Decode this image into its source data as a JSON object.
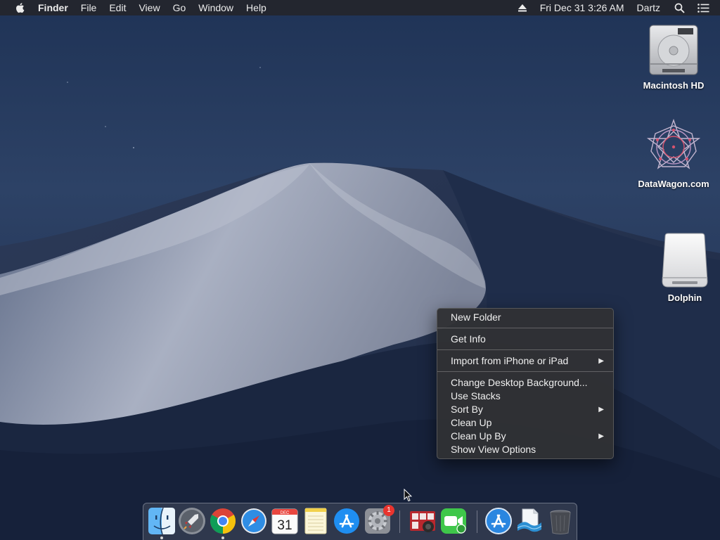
{
  "menubar": {
    "app_name": "Finder",
    "menus": [
      "File",
      "Edit",
      "View",
      "Go",
      "Window",
      "Help"
    ],
    "clock": "Fri Dec 31  3:26 AM",
    "user": "Dartz"
  },
  "desktop_icons": {
    "macintosh_hd": "Macintosh HD",
    "datawagon": "DataWagon.com",
    "dolphin": "Dolphin"
  },
  "context_menu": {
    "new_folder": "New Folder",
    "get_info": "Get Info",
    "import_iphone": "Import from iPhone or iPad",
    "change_background": "Change Desktop Background...",
    "use_stacks": "Use Stacks",
    "sort_by": "Sort By",
    "clean_up": "Clean Up",
    "clean_up_by": "Clean Up By",
    "show_view_options": "Show View Options",
    "submenu_arrow": "▶"
  },
  "dock": {
    "calendar_month": "DEC",
    "calendar_day": "31",
    "system_prefs_badge": "1"
  },
  "colors": {
    "menu_bg": "#303134",
    "badge_red": "#e9342e",
    "facetime_green": "#3fc74a",
    "appstore_blue": "#1f8ef1"
  }
}
